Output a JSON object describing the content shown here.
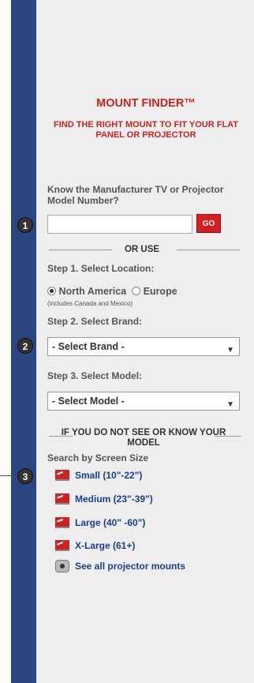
{
  "mount_finder": {
    "title": "MOUNT FINDER™",
    "subtitle": "FIND THE RIGHT MOUNT TO FIT YOUR FLAT PANEL OR PROJECTOR",
    "know_label": "Know the Manufacturer TV or Projector Model Number?",
    "model_input": {
      "value": "",
      "placeholder": ""
    },
    "go_label": "GO",
    "or_use": "OR USE",
    "step1_label": "Step 1. Select Location:",
    "location_options": [
      {
        "label": "North America",
        "selected": true
      },
      {
        "label": "Europe",
        "selected": false
      }
    ],
    "location_note": "(includes Canada and Mexico)",
    "step2_label": "Step 2. Select Brand:",
    "brand_select": "- Select Brand -",
    "step3_label": "Step 3. Select Model:",
    "model_select": "- Select Model -",
    "not_see_text": "IF YOU DO NOT SEE OR KNOW YOUR MODEL",
    "search_label": "Search by Screen Size",
    "sizes": [
      {
        "label": "Small (10\"-22\")",
        "icon": "tv-icon"
      },
      {
        "label": "Medium (23\"-39\")",
        "icon": "tv-icon"
      },
      {
        "label": "Large (40\" -60\")",
        "icon": "tv-icon"
      },
      {
        "label": "X-Large (61+)",
        "icon": "tv-icon"
      }
    ],
    "projector_link": {
      "label": "See all projector mounts",
      "icon": "projector-icon"
    }
  },
  "markers": [
    "1",
    "2",
    "3"
  ],
  "colors": {
    "brand_red": "#cc2222",
    "sidebar_blue": "#2a4580",
    "link_blue": "#1a3f8f",
    "panel_bg": "#eeeeee"
  }
}
